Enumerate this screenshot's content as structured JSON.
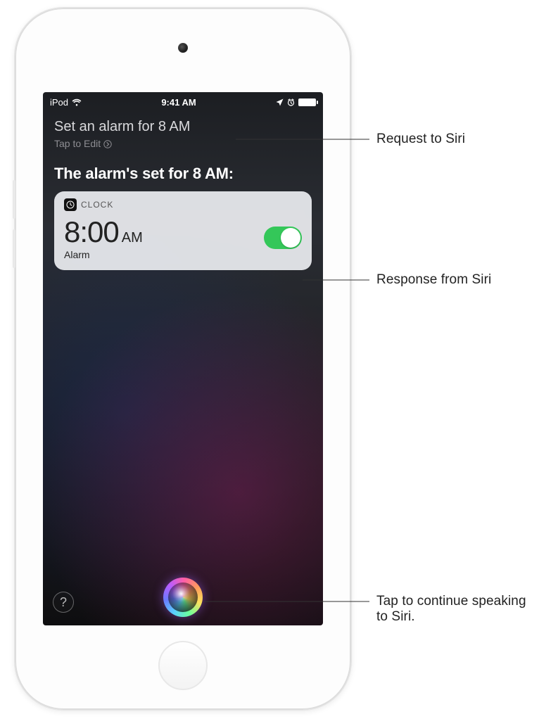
{
  "status_bar": {
    "carrier": "iPod",
    "time": "9:41 AM"
  },
  "siri": {
    "user_request": "Set an alarm for 8 AM",
    "tap_to_edit": "Tap to Edit",
    "response_text": "The alarm's set for 8 AM:"
  },
  "clock_card": {
    "app_name": "CLOCK",
    "time": "8:00",
    "ampm": "AM",
    "label": "Alarm",
    "toggle_on": true
  },
  "help_button_label": "?",
  "callouts": {
    "request": "Request to Siri",
    "response": "Response from Siri",
    "orb": "Tap to continue speaking to Siri."
  }
}
